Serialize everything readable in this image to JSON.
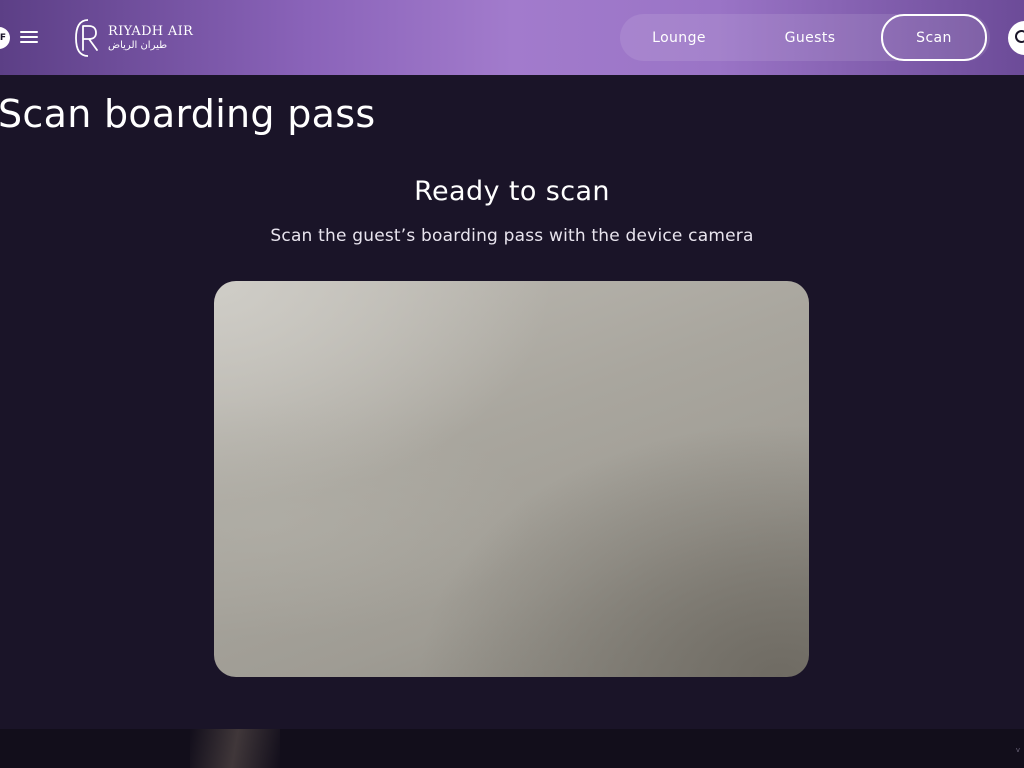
{
  "header": {
    "avatar_initial": "F",
    "menu_icon": "hamburger-menu-icon",
    "logo": {
      "name_en": "RIYADH AIR",
      "name_ar": "طيران الرياض"
    },
    "nav": {
      "items": [
        {
          "label": "Lounge"
        },
        {
          "label": "Guests"
        },
        {
          "label": "Scan",
          "active": true
        }
      ]
    },
    "search_icon": "search-icon"
  },
  "main": {
    "title": "Scan boarding pass",
    "status_heading": "Ready to scan",
    "status_subtitle": "Scan the guest’s boarding pass with the device camera"
  },
  "footer": {
    "version_text": "v"
  },
  "colors": {
    "background": "#1a1428",
    "header_gradient_start": "#5c3f86",
    "header_gradient_mid": "#a27bcc",
    "text_primary": "#ffffff"
  }
}
